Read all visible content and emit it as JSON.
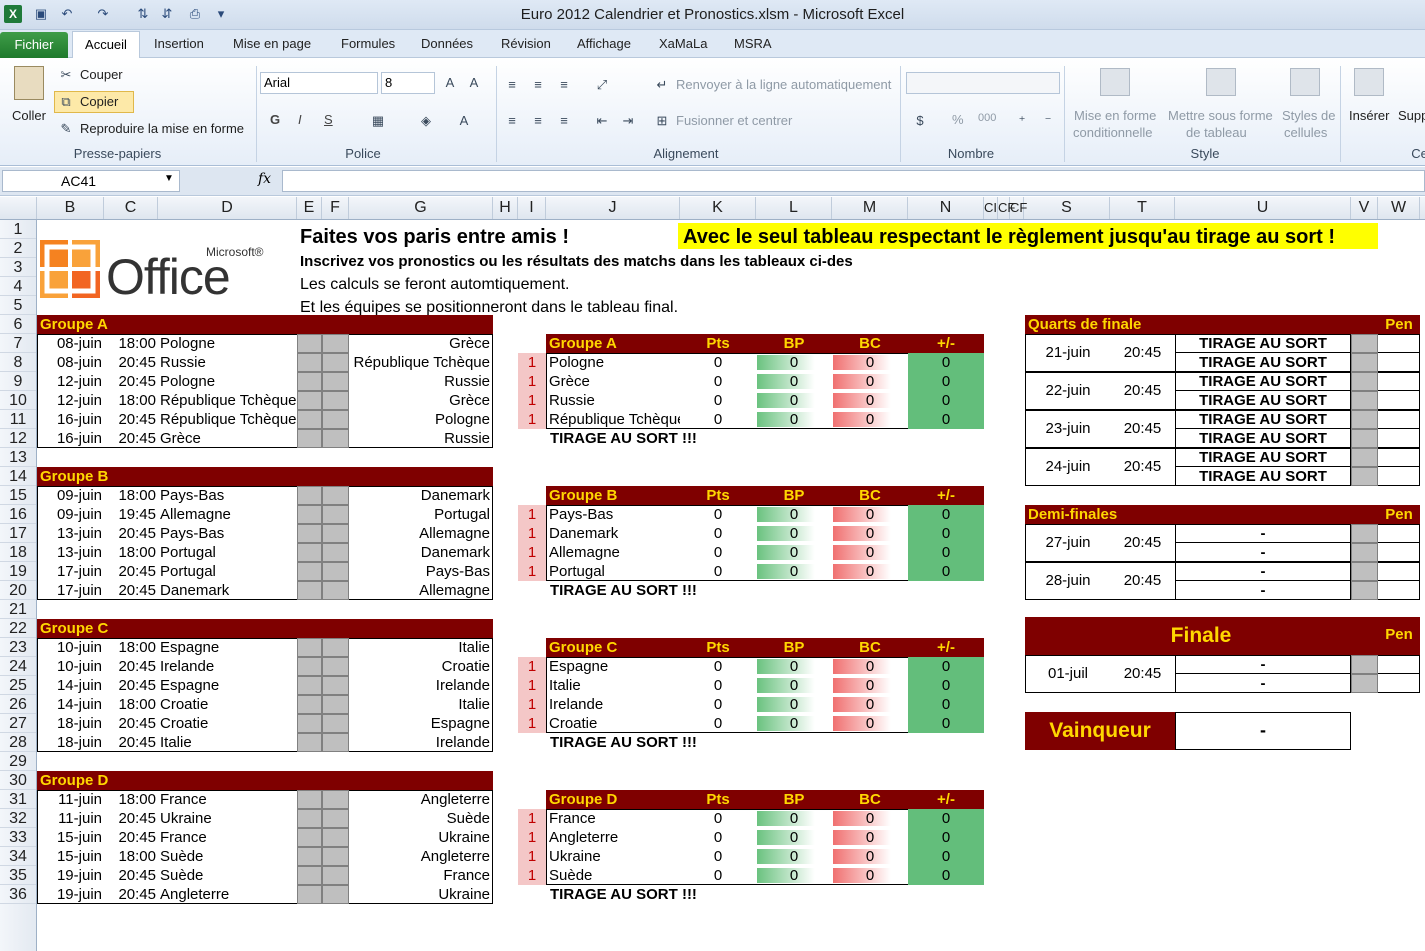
{
  "window": {
    "title": "Euro 2012 Calendrier et Pronostics.xlsm  -  Microsoft Excel"
  },
  "tabs": [
    "Fichier",
    "Accueil",
    "Insertion",
    "Mise en page",
    "Formules",
    "Données",
    "Révision",
    "Affichage",
    "XaMaLa",
    "MSRA"
  ],
  "ribbon": {
    "clipboard": {
      "paste": "Coller",
      "cut": "Couper",
      "copy": "Copier",
      "format_painter": "Reproduire la mise en forme",
      "group": "Presse-papiers"
    },
    "font": {
      "name": "Arial",
      "size": "8",
      "bold": "G",
      "italic": "I",
      "underline": "S",
      "group": "Police"
    },
    "alignment": {
      "wrap": "Renvoyer à la ligne automatiquement",
      "merge": "Fusionner et centrer",
      "group": "Alignement"
    },
    "number": {
      "percent": "%",
      "thousands": "000",
      "group": "Nombre"
    },
    "style": {
      "conditional": "Mise en forme",
      "conditional2": "conditionnelle",
      "table": "Mettre sous forme",
      "table2": "de tableau",
      "cell_styles": "Styles de",
      "cell_styles2": "cellules",
      "group": "Style"
    },
    "cells": {
      "insert": "Insérer",
      "delete": "Supp",
      "group": "Cel"
    }
  },
  "formula_bar": {
    "name_box": "AC41",
    "fx": "fx",
    "value": ""
  },
  "columns": [
    "B",
    "C",
    "D",
    "E",
    "F",
    "G",
    "H",
    "I",
    "J",
    "K",
    "L",
    "M",
    "N",
    "CI",
    "CF",
    "CF",
    "S",
    "T",
    "U",
    "V",
    "W"
  ],
  "rows": [
    "1",
    "2",
    "3",
    "4",
    "5",
    "6",
    "7",
    "8",
    "9",
    "10",
    "11",
    "12",
    "13",
    "14",
    "15",
    "16",
    "17",
    "18",
    "19",
    "20",
    "21",
    "22",
    "23",
    "24",
    "25",
    "26",
    "27",
    "28",
    "29",
    "30",
    "31",
    "32",
    "33",
    "34",
    "35",
    "36"
  ],
  "logo": {
    "brand": "Microsoft®",
    "product": "Office"
  },
  "header": {
    "title": "Faites vos paris entre amis !",
    "highlight": "Avec le seul tableau respectant le règlement jusqu'au tirage au sort !",
    "line2": "Inscrivez vos pronostics ou les résultats des matchs dans les tableaux ci-des",
    "line3": "Les calculs se feront automtiquement.",
    "line4": "Et les équipes se positionneront dans le tableau final."
  },
  "groups": [
    {
      "name": "Groupe A",
      "matches": [
        [
          "08-juin",
          "18:00",
          "Pologne",
          "Grèce"
        ],
        [
          "08-juin",
          "20:45",
          "Russie",
          "République Tchèque"
        ],
        [
          "12-juin",
          "20:45",
          "Pologne",
          "Russie"
        ],
        [
          "12-juin",
          "18:00",
          "République Tchèque",
          "Grèce"
        ],
        [
          "16-juin",
          "20:45",
          "République Tchèque",
          "Pologne"
        ],
        [
          "16-juin",
          "20:45",
          "Grèce",
          "Russie"
        ]
      ],
      "standings": [
        "Pologne",
        "Grèce",
        "Russie",
        "République Tchèque"
      ]
    },
    {
      "name": "Groupe B",
      "matches": [
        [
          "09-juin",
          "18:00",
          "Pays-Bas",
          "Danemark"
        ],
        [
          "09-juin",
          "19:45",
          "Allemagne",
          "Portugal"
        ],
        [
          "13-juin",
          "20:45",
          "Pays-Bas",
          "Allemagne"
        ],
        [
          "13-juin",
          "18:00",
          "Portugal",
          "Danemark"
        ],
        [
          "17-juin",
          "20:45",
          "Portugal",
          "Pays-Bas"
        ],
        [
          "17-juin",
          "20:45",
          "Danemark",
          "Allemagne"
        ]
      ],
      "standings": [
        "Pays-Bas",
        "Danemark",
        "Allemagne",
        "Portugal"
      ]
    },
    {
      "name": "Groupe C",
      "matches": [
        [
          "10-juin",
          "18:00",
          "Espagne",
          "Italie"
        ],
        [
          "10-juin",
          "20:45",
          "Irelande",
          "Croatie"
        ],
        [
          "14-juin",
          "20:45",
          "Espagne",
          "Irelande"
        ],
        [
          "14-juin",
          "18:00",
          "Croatie",
          "Italie"
        ],
        [
          "18-juin",
          "20:45",
          "Croatie",
          "Espagne"
        ],
        [
          "18-juin",
          "20:45",
          "Italie",
          "Irelande"
        ]
      ],
      "standings": [
        "Espagne",
        "Italie",
        "Irelande",
        "Croatie"
      ]
    },
    {
      "name": "Groupe D",
      "matches": [
        [
          "11-juin",
          "18:00",
          "France",
          "Angleterre"
        ],
        [
          "11-juin",
          "20:45",
          "Ukraine",
          "Suède"
        ],
        [
          "15-juin",
          "20:45",
          "France",
          "Ukraine"
        ],
        [
          "15-juin",
          "18:00",
          "Suède",
          "Angleterre"
        ],
        [
          "19-juin",
          "20:45",
          "Suède",
          "France"
        ],
        [
          "19-juin",
          "20:45",
          "Angleterre",
          "Ukraine"
        ]
      ],
      "standings": [
        "France",
        "Angleterre",
        "Ukraine",
        "Suède"
      ]
    }
  ],
  "standings_headers": {
    "pts": "Pts",
    "bp": "BP",
    "bc": "BC",
    "diff": "+/-"
  },
  "standings_values": {
    "rank": "1",
    "zero": "0"
  },
  "draw_note": "TIRAGE AU SORT !!!",
  "knockout": {
    "quarters": {
      "title": "Quarts de finale",
      "pen": "Pen",
      "matches": [
        [
          "21-juin",
          "20:45"
        ],
        [
          "22-juin",
          "20:45"
        ],
        [
          "23-juin",
          "20:45"
        ],
        [
          "24-juin",
          "20:45"
        ]
      ],
      "team": "TIRAGE AU SORT"
    },
    "semis": {
      "title": "Demi-finales",
      "pen": "Pen",
      "matches": [
        [
          "27-juin",
          "20:45"
        ],
        [
          "28-juin",
          "20:45"
        ]
      ],
      "team": "-"
    },
    "final": {
      "title": "Finale",
      "pen": "Pen",
      "date": "01-juil",
      "time": "20:45",
      "team": "-"
    },
    "winner": {
      "label": "Vainqueur",
      "value": "-"
    }
  }
}
